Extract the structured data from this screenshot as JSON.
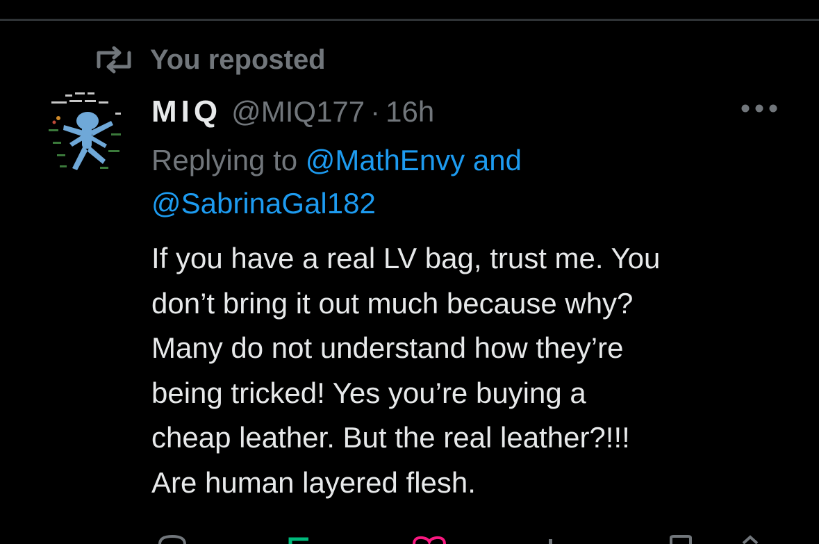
{
  "repost": {
    "icon": "repost-icon",
    "label": "You reposted"
  },
  "tweet": {
    "avatar_icon": "avatar-illustration",
    "display_name": "MIQ",
    "handle": "@MIQ177",
    "separator": "·",
    "time": "16h",
    "more_icon": "more-dots-icon",
    "replying": {
      "prefix": "Replying to",
      "mention_1": "@MathEnvy",
      "conjunction": "and",
      "mention_2": "@SabrinaGal182"
    },
    "body_lines": [
      "If you have a real LV bag, trust me. You",
      "don’t bring it out much because why?",
      "Many do not understand how they’re",
      "being tricked! Yes you’re buying a",
      "cheap leather. But the real leather?!!!",
      "Are human layered flesh."
    ]
  },
  "colors": {
    "background": "#000000",
    "primary_text": "#e7e9ea",
    "secondary_text": "#71767b",
    "link": "#1d9bf0",
    "divider": "#2f3336"
  }
}
